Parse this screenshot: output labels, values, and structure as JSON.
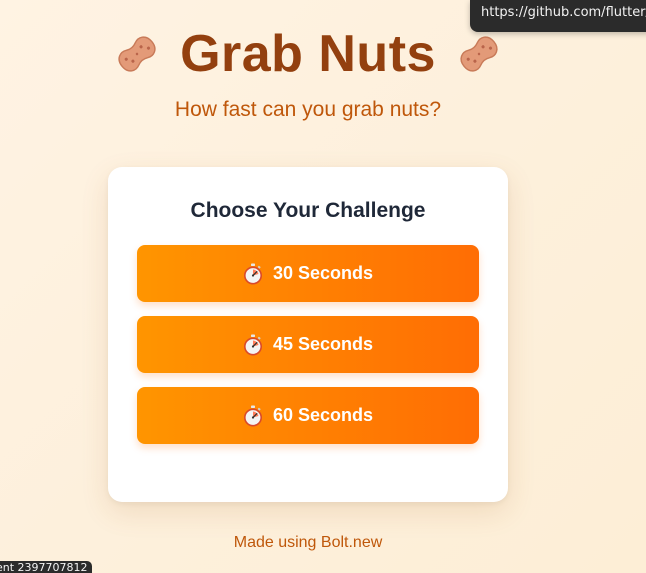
{
  "tooltip": {
    "url": "https://github.com/flutter/"
  },
  "header": {
    "title": "Grab Nuts",
    "subtitle": "How fast can you grab nuts?",
    "decoration_icon": "peanut-icon"
  },
  "challenge": {
    "title": "Choose Your Challenge",
    "button_icon": "stopwatch-icon",
    "options": [
      {
        "label": "30 Seconds"
      },
      {
        "label": "45 Seconds"
      },
      {
        "label": "60 Seconds"
      }
    ]
  },
  "footer": {
    "text": "Made using Bolt.new"
  },
  "status_bar": {
    "text": "ent 2397707812"
  },
  "colors": {
    "title": "#93400f",
    "subtitle": "#bf570a",
    "button_start": "#ff9500",
    "button_end": "#ff6d04",
    "card_title": "#1f2838"
  }
}
